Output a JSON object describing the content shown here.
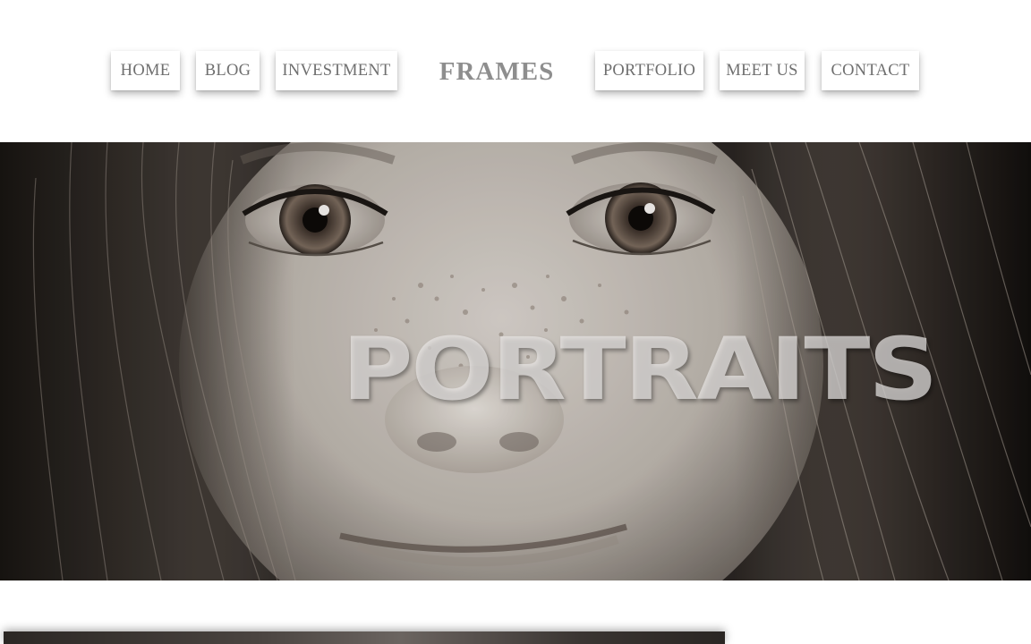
{
  "nav": {
    "left_items": [
      {
        "label": "HOME"
      },
      {
        "label": "BLOG"
      },
      {
        "label": "INVESTMENT"
      }
    ],
    "logo": "FRAMES",
    "right_items": [
      {
        "label": "PORTFOLIO"
      },
      {
        "label": "MEET US"
      },
      {
        "label": "CONTACT"
      }
    ]
  },
  "hero": {
    "title": "PORTRAITS",
    "image": "black-and-white close-up portrait photo"
  },
  "colors": {
    "nav_text": "#6f6f6f",
    "logo_text": "#8e8e8e",
    "background": "#ffffff"
  }
}
